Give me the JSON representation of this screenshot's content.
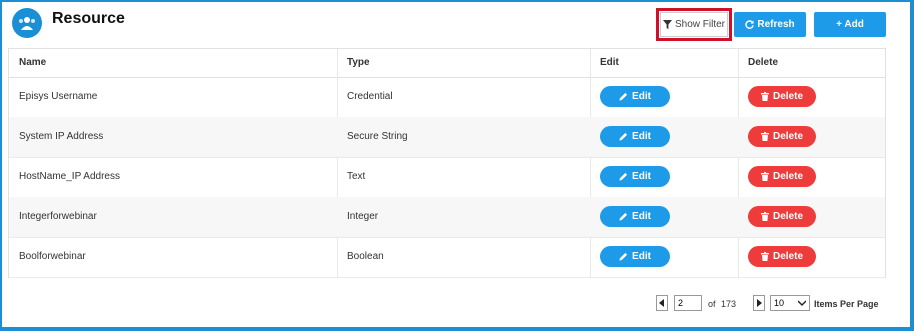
{
  "header": {
    "title": "Resource"
  },
  "toolbar": {
    "show_filter_label": "Show Filter",
    "refresh_label": "Refresh",
    "add_label": "+ Add"
  },
  "table": {
    "columns": [
      "Name",
      "Type",
      "Edit",
      "Delete"
    ],
    "rows": [
      {
        "name": "Episys Username",
        "type": "Credential"
      },
      {
        "name": "System IP Address",
        "type": "Secure String"
      },
      {
        "name": "HostName_IP Address",
        "type": "Text"
      },
      {
        "name": "Integerforwebinar",
        "type": "Integer"
      },
      {
        "name": "Boolforwebinar",
        "type": "Boolean"
      }
    ],
    "edit_label": "Edit",
    "delete_label": "Delete"
  },
  "pagination": {
    "current_page": "2",
    "of_label": "of",
    "total_pages": "173",
    "per_page": "10",
    "per_page_label": "Items Per Page"
  },
  "colors": {
    "primary": "#1e9be8",
    "danger": "#ee3b3b",
    "highlight": "#d0102a"
  },
  "icons": [
    "users-icon",
    "filter-icon",
    "refresh-icon",
    "pencil-icon",
    "trash-icon",
    "chevron-left-icon",
    "chevron-right-icon",
    "chevron-down-icon"
  ]
}
